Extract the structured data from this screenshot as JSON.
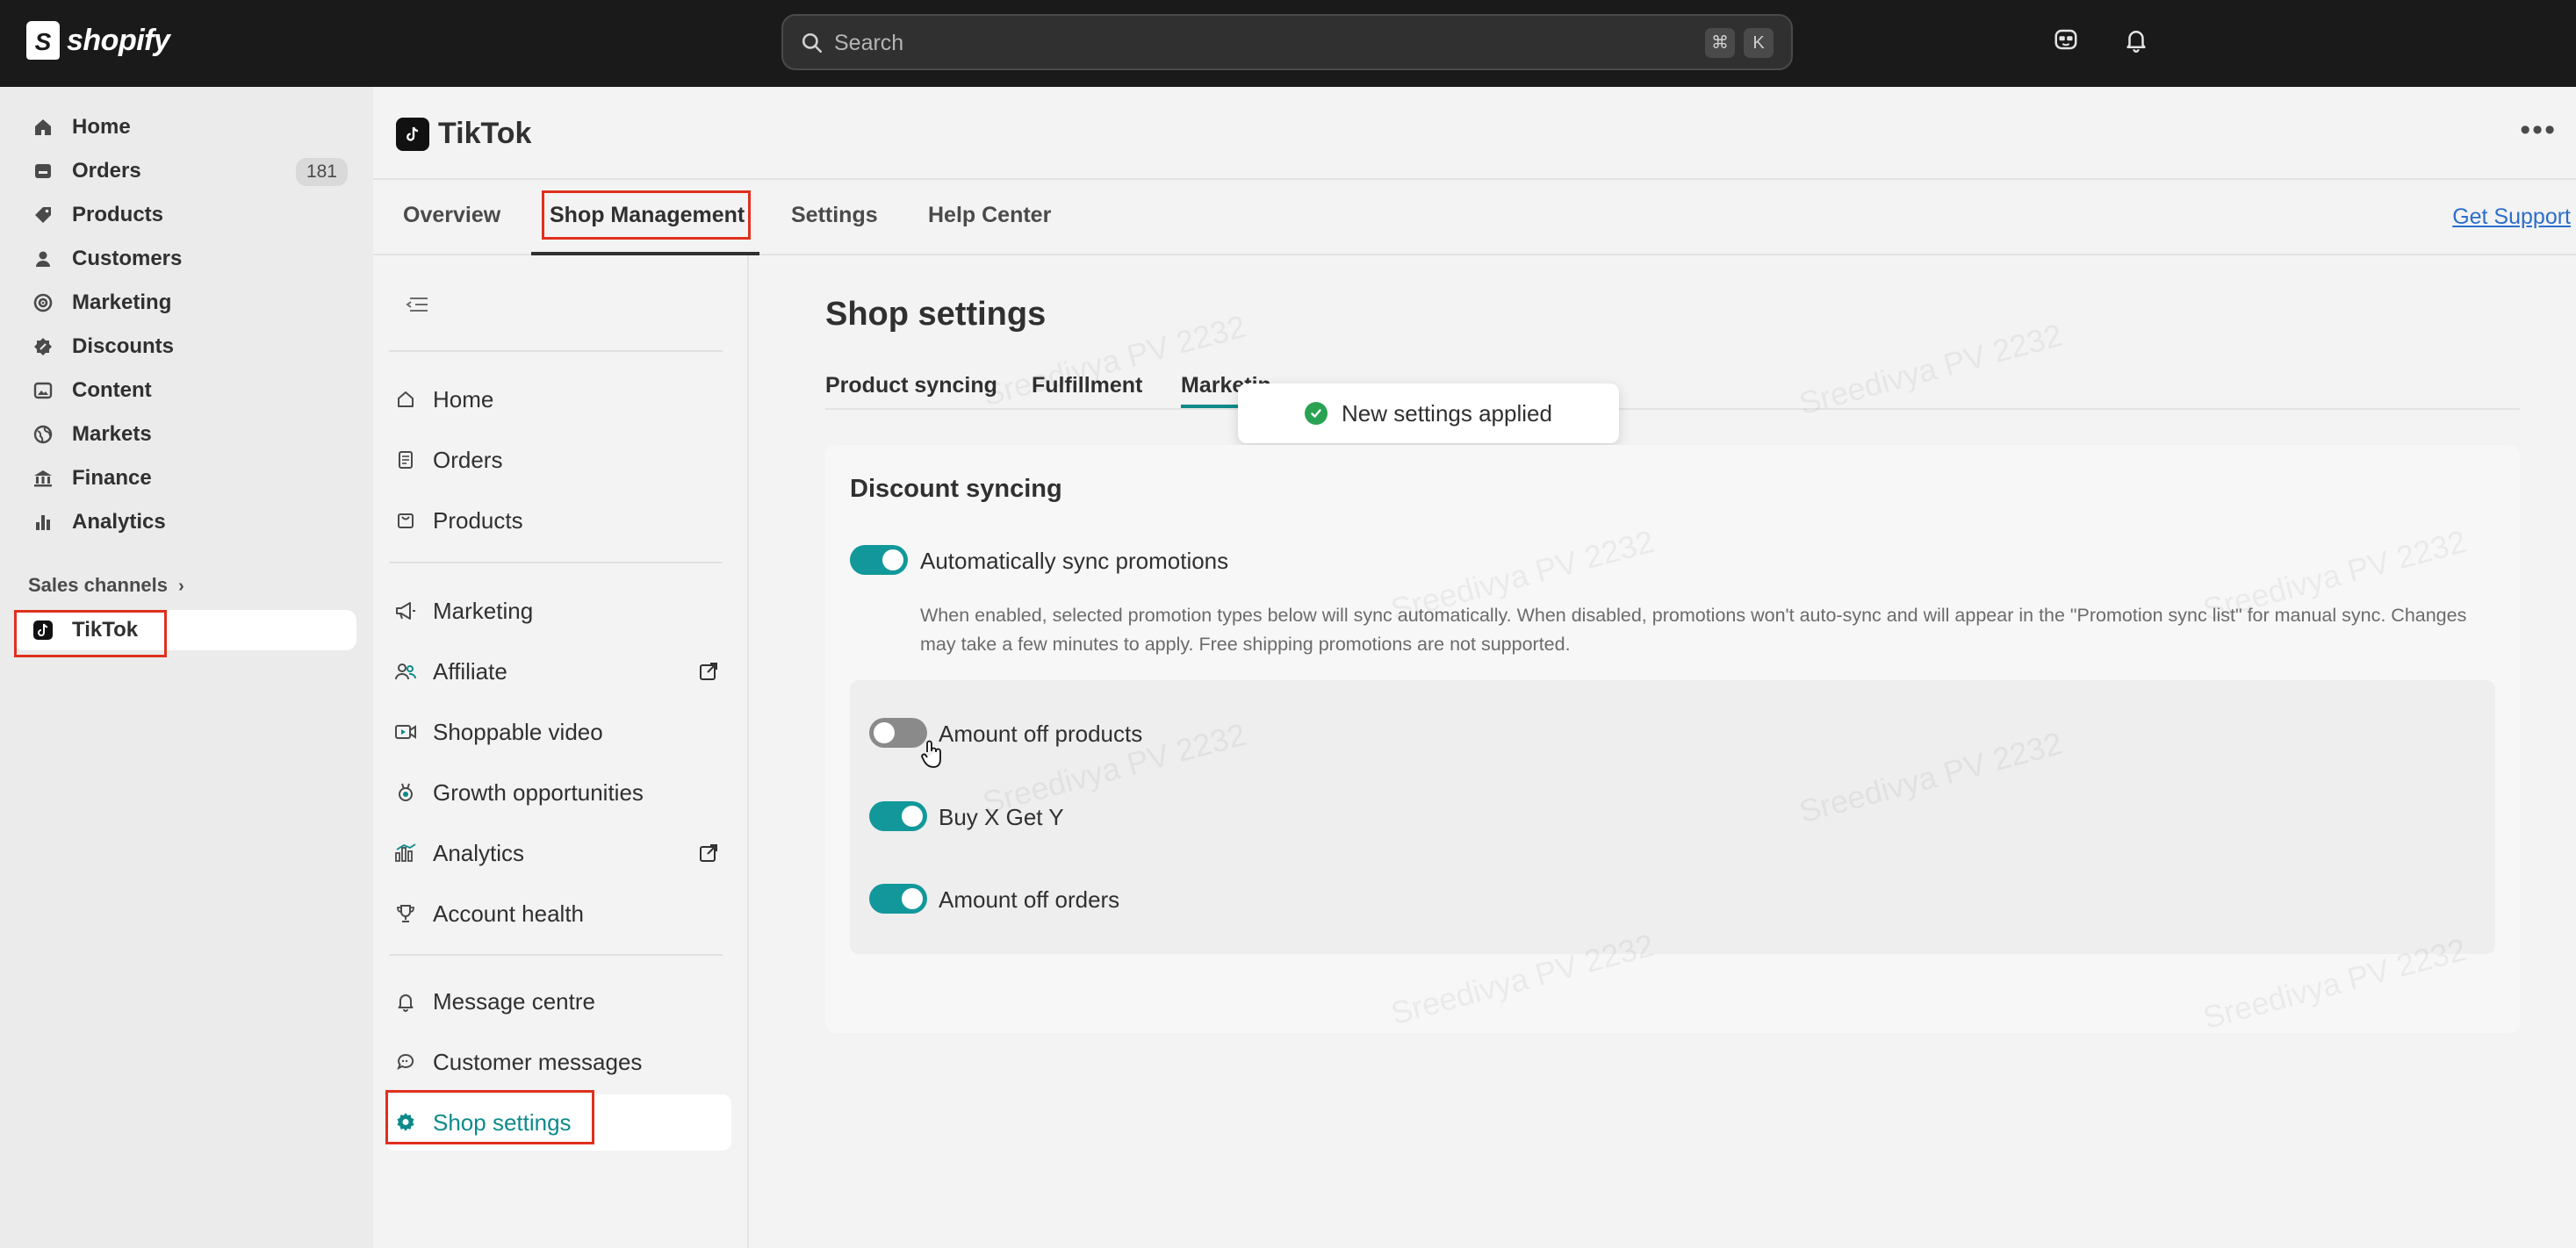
{
  "topbar": {
    "logo_text": "shopify",
    "logo_letter": "S",
    "search_placeholder": "Search",
    "shortcut_keys": [
      "⌘",
      "K"
    ]
  },
  "leftnav": {
    "items": [
      {
        "label": "Home",
        "icon": "home-icon"
      },
      {
        "label": "Orders",
        "icon": "orders-icon",
        "badge": "181"
      },
      {
        "label": "Products",
        "icon": "tag-icon"
      },
      {
        "label": "Customers",
        "icon": "person-icon"
      },
      {
        "label": "Marketing",
        "icon": "target-icon"
      },
      {
        "label": "Discounts",
        "icon": "discount-icon"
      },
      {
        "label": "Content",
        "icon": "image-icon"
      },
      {
        "label": "Markets",
        "icon": "globe-icon"
      },
      {
        "label": "Finance",
        "icon": "bank-icon"
      },
      {
        "label": "Analytics",
        "icon": "bar-chart-icon"
      }
    ],
    "sales_channels_label": "Sales channels",
    "channel": "TikTok"
  },
  "app": {
    "title": "TikTok",
    "tabs": [
      "Overview",
      "Shop Management",
      "Settings",
      "Help Center"
    ],
    "active_tab": "Shop Management",
    "support_link": "Get Support"
  },
  "subnav": {
    "group1": [
      "Home",
      "Orders",
      "Products"
    ],
    "group2": [
      "Marketing",
      "Affiliate",
      "Shoppable video",
      "Growth opportunities",
      "Analytics",
      "Account health"
    ],
    "group3": [
      "Message centre",
      "Customer messages",
      "Shop settings"
    ],
    "active": "Shop settings"
  },
  "content": {
    "title": "Shop settings",
    "sub_tabs": [
      "Product syncing",
      "Fulfillment",
      "Marketin"
    ],
    "active_sub_tab": "Marketin",
    "toast": "New settings applied",
    "card_title": "Discount syncing",
    "main_toggle": {
      "label": "Automatically sync promotions",
      "on": true
    },
    "help_text": "When enabled, selected promotion types below will sync automatically. When disabled, promotions won't auto-sync and will appear in the \"Promotion sync list\" for manual sync. Changes may take a few minutes to apply. Free shipping promotions are not supported.",
    "options": [
      {
        "label": "Amount off products",
        "on": false
      },
      {
        "label": "Buy X Get Y",
        "on": true
      },
      {
        "label": "Amount off orders",
        "on": true
      }
    ]
  },
  "watermark": "Sreedivya PV 2232",
  "colors": {
    "accent": "#12989b",
    "highlight_box": "#e0301e",
    "success": "#29a352"
  }
}
